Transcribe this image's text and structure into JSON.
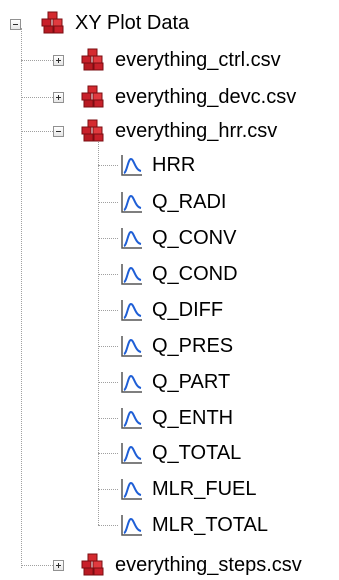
{
  "tree": {
    "root": {
      "label": "XY Plot Data",
      "icon": "bricks-folder-icon",
      "expanded": true
    },
    "files": [
      {
        "label": "everything_ctrl.csv",
        "icon": "bricks-file-icon",
        "expanded": false
      },
      {
        "label": "everything_devc.csv",
        "icon": "bricks-file-icon",
        "expanded": false
      },
      {
        "label": "everything_hrr.csv",
        "icon": "bricks-file-icon",
        "expanded": true,
        "series": [
          {
            "label": "HRR",
            "icon": "plot-series-icon"
          },
          {
            "label": "Q_RADI",
            "icon": "plot-series-icon"
          },
          {
            "label": "Q_CONV",
            "icon": "plot-series-icon"
          },
          {
            "label": "Q_COND",
            "icon": "plot-series-icon"
          },
          {
            "label": "Q_DIFF",
            "icon": "plot-series-icon"
          },
          {
            "label": "Q_PRES",
            "icon": "plot-series-icon"
          },
          {
            "label": "Q_PART",
            "icon": "plot-series-icon"
          },
          {
            "label": "Q_ENTH",
            "icon": "plot-series-icon"
          },
          {
            "label": "Q_TOTAL",
            "icon": "plot-series-icon"
          },
          {
            "label": "MLR_FUEL",
            "icon": "plot-series-icon"
          },
          {
            "label": "MLR_TOTAL",
            "icon": "plot-series-icon"
          }
        ]
      },
      {
        "label": "everything_steps.csv",
        "icon": "bricks-file-icon",
        "expanded": false
      }
    ]
  },
  "colors": {
    "brick_red": "#c8202a",
    "brick_dark": "#7a0d12",
    "plot_blue": "#1f5fd6",
    "connector": "#a0a0a0"
  }
}
